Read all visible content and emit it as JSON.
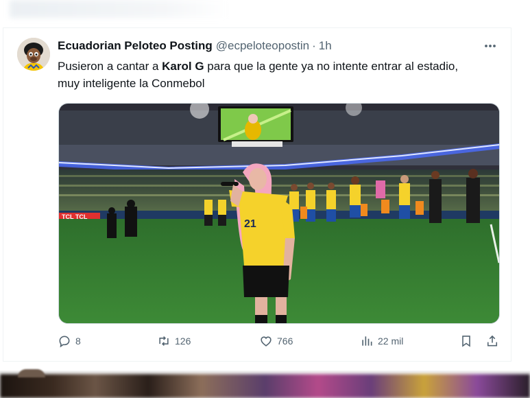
{
  "tweet": {
    "display_name": "Ecuadorian Peloteo Posting",
    "handle": "@ecpeloteopostin",
    "separator": "·",
    "time": "1h",
    "text_before": "Pusieron a cantar a ",
    "text_bold": "Karol G",
    "text_after": " para que la gente ya no intente entrar al estadio, muy inteligente la Conmebol",
    "media": {
      "player_number": "21",
      "ad_board_text": "TCL TCL"
    },
    "actions": {
      "reply_count": "8",
      "retweet_count": "126",
      "like_count": "766",
      "views_count": "22 mil"
    }
  },
  "icons": {
    "more": "more-horizontal-icon",
    "reply": "reply-icon",
    "retweet": "retweet-icon",
    "like": "heart-icon",
    "views": "analytics-icon",
    "bookmark": "bookmark-icon",
    "share": "share-icon"
  },
  "colors": {
    "text_primary": "#0f1419",
    "text_secondary": "#536471",
    "border": "#eff3f4",
    "jersey_yellow": "#f5d22b",
    "pitch_green": "#2f7d32"
  }
}
